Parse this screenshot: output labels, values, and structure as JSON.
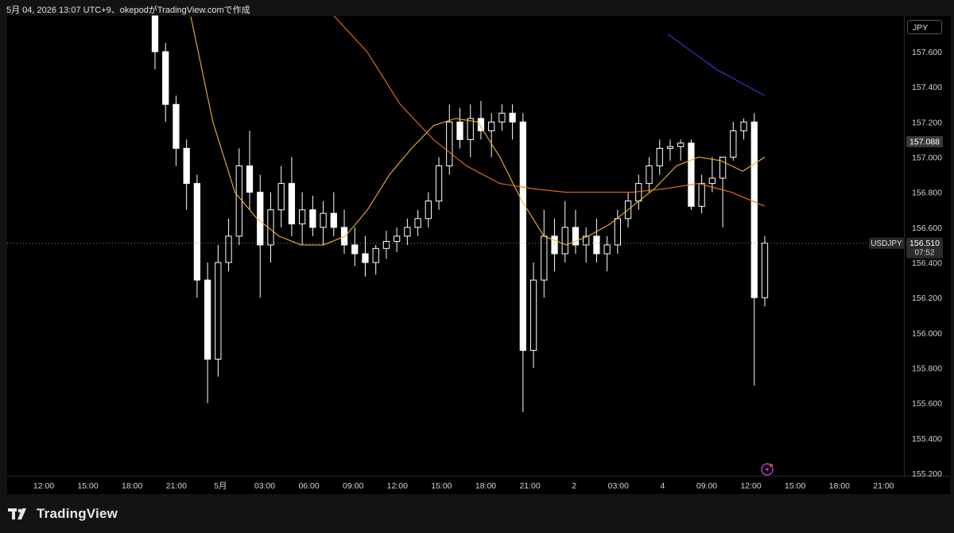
{
  "header": {
    "text": "5月 04, 2026 13:07 UTC+9、okepodがTradingView.comで作成"
  },
  "currency_label": "JPY",
  "brand": {
    "name": "TradingView"
  },
  "colors": {
    "candle": "#ffffff",
    "ma_short": "#f0b429",
    "ma_mid": "#e8731f",
    "ma_long": "#3a3ae8",
    "price_tag_bg": "#2b2b2b"
  },
  "markers": {
    "symbol_tag": "USDJPY",
    "last_price": "156.510",
    "countdown": "07:52",
    "highlight_price": "157.088"
  },
  "chart_data": {
    "type": "candlestick",
    "symbol": "USDJPY",
    "ylim": [
      155.2,
      157.75
    ],
    "y_ticks": [
      "157.600",
      "157.400",
      "157.200",
      "157.000",
      "156.800",
      "156.600",
      "156.400",
      "156.200",
      "156.000",
      "155.800",
      "155.600",
      "155.400",
      "155.200"
    ],
    "x_ticks": [
      "12:00",
      "15:00",
      "18:00",
      "21:00",
      "5月",
      "03:00",
      "06:00",
      "09:00",
      "12:00",
      "15:00",
      "18:00",
      "21:00",
      "2",
      "03:00",
      "4",
      "09:00",
      "12:00",
      "15:00",
      "18:00",
      "21:00"
    ],
    "last_price": 156.51,
    "candles_ohlc": [
      [
        157.9,
        157.95,
        157.5,
        157.6
      ],
      [
        157.6,
        157.65,
        157.2,
        157.3
      ],
      [
        157.3,
        157.35,
        156.95,
        157.05
      ],
      [
        157.05,
        157.1,
        156.7,
        156.85
      ],
      [
        156.85,
        156.9,
        156.2,
        156.3
      ],
      [
        156.3,
        156.4,
        155.6,
        155.85
      ],
      [
        155.85,
        156.5,
        155.75,
        156.4
      ],
      [
        156.4,
        156.65,
        156.35,
        156.55
      ],
      [
        156.55,
        157.05,
        156.5,
        156.95
      ],
      [
        156.95,
        157.15,
        156.7,
        156.8
      ],
      [
        156.8,
        156.9,
        156.2,
        156.5
      ],
      [
        156.5,
        156.8,
        156.4,
        156.7
      ],
      [
        156.7,
        156.95,
        156.6,
        156.85
      ],
      [
        156.85,
        157.0,
        156.55,
        156.62
      ],
      [
        156.62,
        156.8,
        156.5,
        156.7
      ],
      [
        156.7,
        156.78,
        156.55,
        156.6
      ],
      [
        156.6,
        156.75,
        156.5,
        156.68
      ],
      [
        156.68,
        156.8,
        156.55,
        156.6
      ],
      [
        156.6,
        156.7,
        156.45,
        156.5
      ],
      [
        156.5,
        156.6,
        156.38,
        156.45
      ],
      [
        156.45,
        156.55,
        156.32,
        156.4
      ],
      [
        156.4,
        156.5,
        156.33,
        156.48
      ],
      [
        156.48,
        156.58,
        156.42,
        156.52
      ],
      [
        156.52,
        156.6,
        156.46,
        156.55
      ],
      [
        156.55,
        156.65,
        156.5,
        156.6
      ],
      [
        156.6,
        156.7,
        156.55,
        156.65
      ],
      [
        156.65,
        156.8,
        156.6,
        156.75
      ],
      [
        156.75,
        157.0,
        156.7,
        156.95
      ],
      [
        156.95,
        157.3,
        156.9,
        157.2
      ],
      [
        157.2,
        157.28,
        157.05,
        157.1
      ],
      [
        157.1,
        157.3,
        157.0,
        157.22
      ],
      [
        157.22,
        157.32,
        157.1,
        157.15
      ],
      [
        157.15,
        157.25,
        157.0,
        157.2
      ],
      [
        157.2,
        157.3,
        157.15,
        157.25
      ],
      [
        157.25,
        157.3,
        157.1,
        157.2
      ],
      [
        157.2,
        157.25,
        155.55,
        155.9
      ],
      [
        155.9,
        156.4,
        155.8,
        156.3
      ],
      [
        156.3,
        156.7,
        156.2,
        156.55
      ],
      [
        156.55,
        156.65,
        156.35,
        156.45
      ],
      [
        156.45,
        156.75,
        156.4,
        156.6
      ],
      [
        156.6,
        156.7,
        156.45,
        156.5
      ],
      [
        156.5,
        156.6,
        156.4,
        156.55
      ],
      [
        156.55,
        156.65,
        156.4,
        156.45
      ],
      [
        156.45,
        156.55,
        156.35,
        156.5
      ],
      [
        156.5,
        156.7,
        156.45,
        156.65
      ],
      [
        156.65,
        156.8,
        156.6,
        156.75
      ],
      [
        156.75,
        156.9,
        156.7,
        156.85
      ],
      [
        156.85,
        157.0,
        156.8,
        156.95
      ],
      [
        156.95,
        157.1,
        156.9,
        157.05
      ],
      [
        157.05,
        157.1,
        156.98,
        157.06
      ],
      [
        157.06,
        157.1,
        156.98,
        157.08
      ],
      [
        157.08,
        157.1,
        156.7,
        156.72
      ],
      [
        156.72,
        156.9,
        156.68,
        156.85
      ],
      [
        156.85,
        157.0,
        156.8,
        156.88
      ],
      [
        156.88,
        157.0,
        156.6,
        157.0
      ],
      [
        157.0,
        157.2,
        156.98,
        157.15
      ],
      [
        157.15,
        157.22,
        157.1,
        157.2
      ],
      [
        157.2,
        157.25,
        155.7,
        156.2
      ],
      [
        156.2,
        156.55,
        156.15,
        156.51
      ]
    ],
    "series": [
      {
        "values": [
          157.8,
          157.2,
          156.8,
          156.65,
          156.55,
          156.5,
          156.5,
          156.55,
          156.7,
          156.9,
          157.05,
          157.18,
          157.22,
          157.2,
          157.0,
          156.75,
          156.55,
          156.5,
          156.55,
          156.62,
          156.72,
          156.82,
          156.95,
          157.0,
          156.98,
          156.92,
          157.0
        ]
      },
      {
        "values": [
          157.9,
          157.6,
          157.3,
          157.1,
          156.95,
          156.85,
          156.82,
          156.8,
          156.8,
          156.8,
          156.82,
          156.85,
          156.8,
          156.72
        ]
      },
      {
        "values": [
          157.7,
          157.5,
          157.35
        ]
      }
    ]
  }
}
